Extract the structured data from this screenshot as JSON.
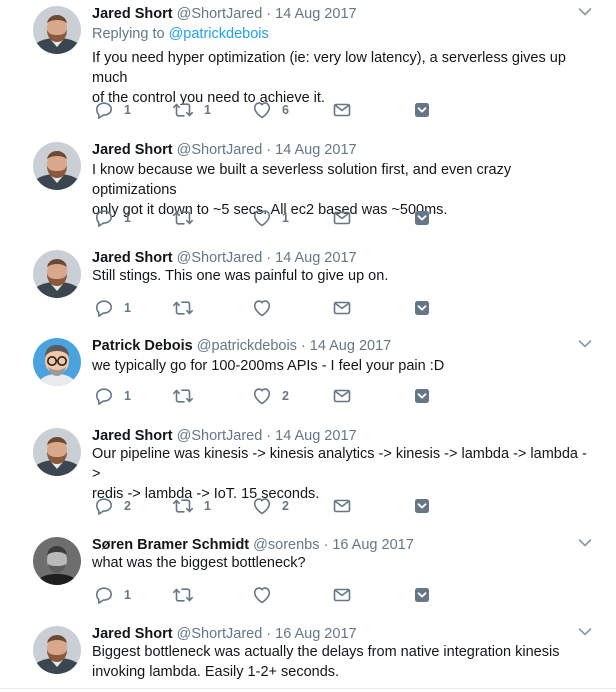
{
  "tweets": [
    {
      "name": "Jared Short",
      "handle": "@ShortJared",
      "date": "14 Aug 2017",
      "replying_label": "Replying to",
      "replying_handle": "@patrickdebois",
      "line1": "If you need hyper optimization (ie: very low latency), a serverless gives up much",
      "line2": "of the control you need to achieve it.",
      "replies": "1",
      "retweets": "1",
      "likes": "6"
    },
    {
      "name": "Jared Short",
      "handle": "@ShortJared",
      "date": "14 Aug 2017",
      "line1": "I know because we built a severless solution first, and even crazy optimizations",
      "line2": "only got it down to ~5 secs. All ec2 based was ~500ms.",
      "replies": "1",
      "retweets": "",
      "likes": "1"
    },
    {
      "name": "Jared Short",
      "handle": "@ShortJared",
      "date": "14 Aug 2017",
      "line1": "Still stings. This one was painful to give up on.",
      "replies": "1",
      "retweets": "",
      "likes": ""
    },
    {
      "name": "Patrick Debois",
      "handle": "@patrickdebois",
      "date": "14 Aug 2017",
      "line1": "we typically go for 100-200ms APIs - I feel your pain :D",
      "replies": "1",
      "retweets": "",
      "likes": "2"
    },
    {
      "name": "Jared Short",
      "handle": "@ShortJared",
      "date": "14 Aug 2017",
      "line1": "Our pipeline was kinesis -> kinesis analytics -> kinesis -> lambda -> lambda ->",
      "line2": "redis -> lambda -> IoT. 15 seconds.",
      "replies": "2",
      "retweets": "1",
      "likes": "2"
    },
    {
      "name": "Søren Bramer Schmidt",
      "handle": "@sorenbs",
      "date": "16 Aug 2017",
      "line1": "what was the biggest bottleneck?",
      "replies": "1",
      "retweets": "",
      "likes": ""
    },
    {
      "name": "Jared Short",
      "handle": "@ShortJared",
      "date": "16 Aug 2017",
      "line1": "Biggest bottleneck was actually the delays from native integration kinesis",
      "line2": "invoking lambda. Easily 1-2+ seconds."
    }
  ],
  "colors": {
    "name": "#14171a",
    "meta": "#657786",
    "link": "#1da1f2",
    "icon": "#657786",
    "divider": "#e6ecf0"
  },
  "icons": [
    "reply-icon",
    "retweet-icon",
    "like-icon",
    "direct-message-icon",
    "save-icon",
    "chevron-down-icon"
  ]
}
